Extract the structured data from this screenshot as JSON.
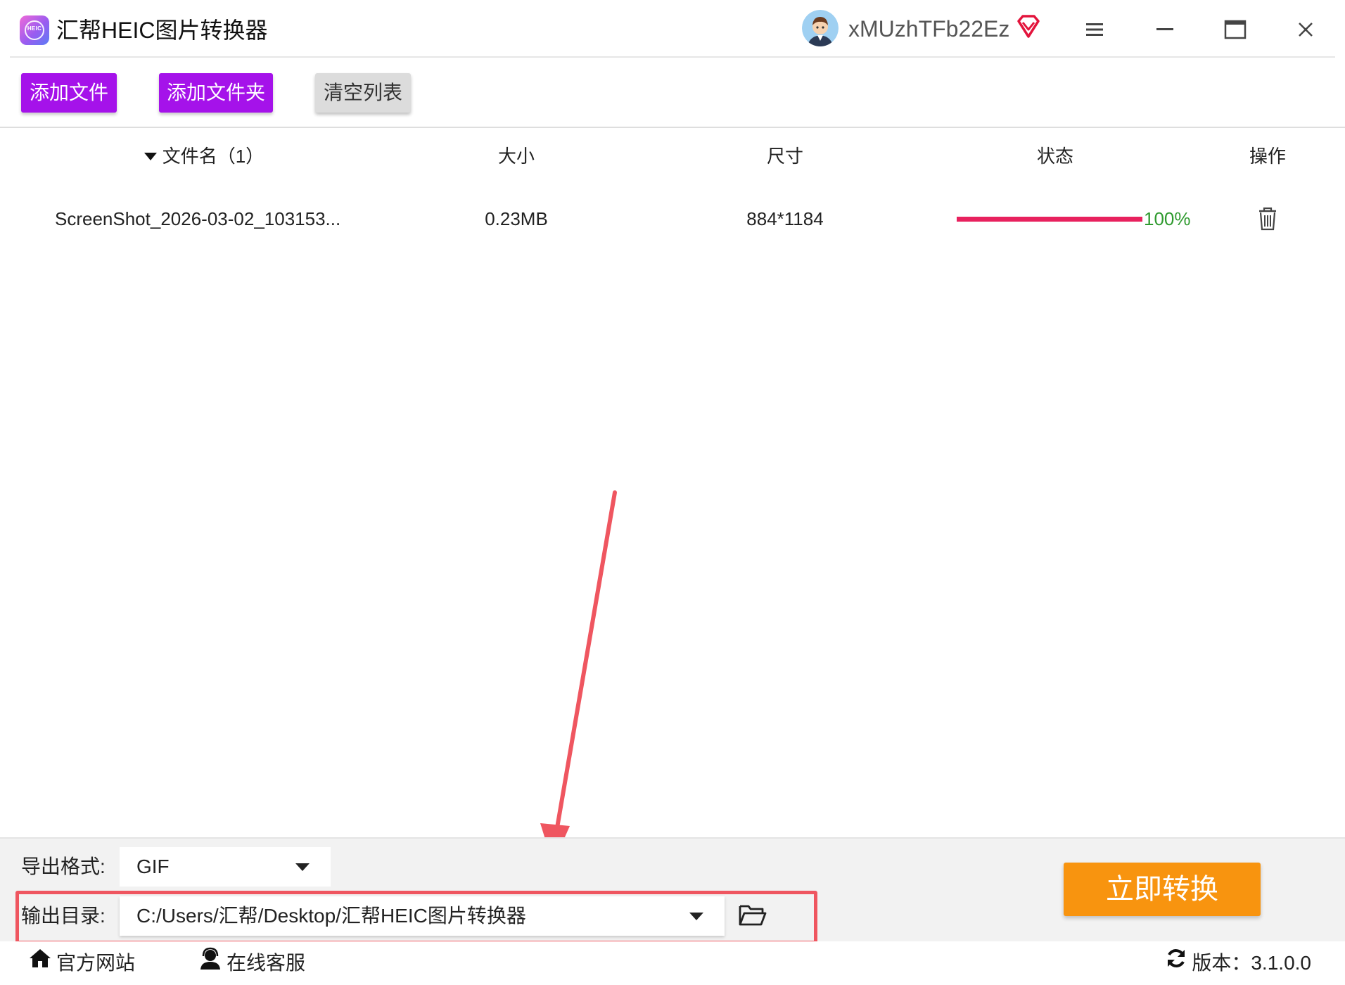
{
  "app": {
    "title": "汇帮HEIC图片转换器",
    "logo_text": "HEIC",
    "username": "xMUzhTFb22Ez"
  },
  "toolbar": {
    "add_file": "添加文件",
    "add_folder": "添加文件夹",
    "clear_list": "清空列表"
  },
  "table": {
    "headers": {
      "name": "文件名（1）",
      "size": "大小",
      "dimensions": "尺寸",
      "status": "状态",
      "action": "操作"
    },
    "rows": [
      {
        "name": "ScreenShot_2026-03-02_103153...",
        "size": "0.23MB",
        "dimensions": "884*1184",
        "progress": 1.0,
        "progress_text": "100%"
      }
    ]
  },
  "export": {
    "format_label": "导出格式:",
    "format_value": "GIF",
    "output_label": "输出目录:",
    "output_value": "C:/Users/汇帮/Desktop/汇帮HEIC图片转换器",
    "convert_button": "立即转换"
  },
  "footer": {
    "website": "官方网站",
    "support": "在线客服",
    "version": "版本：3.1.0.0"
  },
  "colors": {
    "primary_button": "#a512ea",
    "progress_bar": "#e8215e",
    "progress_text": "#2e9a2e",
    "convert_button": "#f8940f",
    "highlight": "#ef5660"
  },
  "icons": {
    "menu": "menu-icon",
    "minimize": "minimize-icon",
    "maximize": "maximize-icon",
    "close": "close-icon",
    "vip": "vip-diamond-icon",
    "delete": "trash-icon",
    "folder": "folder-open-icon",
    "home": "home-icon",
    "support": "headset-icon",
    "refresh": "refresh-icon"
  }
}
